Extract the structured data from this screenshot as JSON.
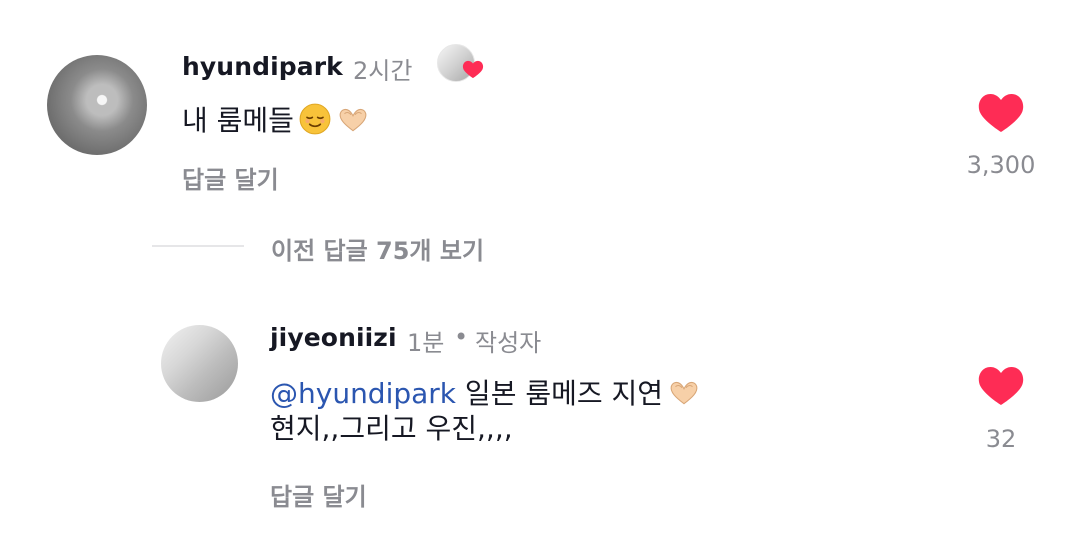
{
  "comments": [
    {
      "username": "hyundipark",
      "time": "2시간",
      "text": "내 룸메들",
      "reply_label": "답글 달기",
      "likes": "3,300",
      "liked": true
    }
  ],
  "view_more": "이전 답글 75개 보기",
  "replies": [
    {
      "username": "jiyeoniizi",
      "time": "1분",
      "separator": "•",
      "author_badge": "작성자",
      "mention": "@hyundipark",
      "text_line1_tail": " 일본 룸메즈 지연",
      "text_line2": "현지,,그리고 우진,,,,",
      "reply_label": "답글 달기",
      "likes": "32",
      "liked": true
    }
  ],
  "colors": {
    "heart": "#fe2c55",
    "meta": "#8a8b91",
    "mention": "#2b56b0"
  },
  "icons": {
    "heart": "heart-icon",
    "smile": "relieved-face-emoji",
    "heart_hands": "heart-hands-emoji"
  }
}
